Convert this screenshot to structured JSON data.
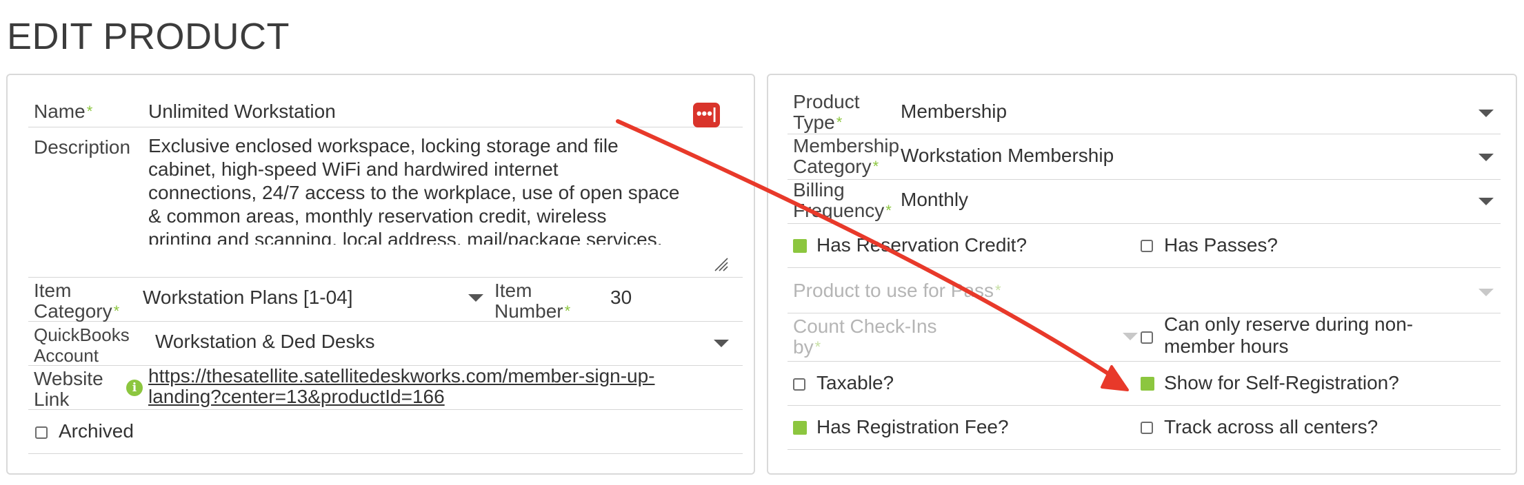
{
  "page": {
    "title": "EDIT PRODUCT"
  },
  "left": {
    "name_label": "Name",
    "name_value": "Unlimited Workstation",
    "description_label": "Description",
    "description_value": "Exclusive enclosed workspace, locking storage and file\ncabinet, high-speed WiFi and hardwired internet\nconnections, 24/7 access to the workplace, use of open space\n& common areas, monthly reservation credit, wireless\nprinting and scanning, local address, mail/package services,\nan online presence on Satellite Workplaces' website, and",
    "item_category_label": "Item Category",
    "item_category_value": "Workstation Plans [1-04]",
    "item_number_label": "Item Number",
    "item_number_value": "30",
    "quickbooks_label": "QuickBooks Account",
    "quickbooks_value": "Workstation & Ded Desks",
    "website_label": "Website Link",
    "website_link_line1": "https://thesatellite.satellitedeskworks.com/member-sign-up-",
    "website_link_line2": "landing?center=13&productId=166",
    "archived_label": "Archived",
    "required_mark": "*"
  },
  "right": {
    "product_type_label": "Product Type",
    "product_type_value": "Membership",
    "membership_category_label": "Membership Category",
    "membership_category_value": "Workstation Membership",
    "billing_frequency_label": "Billing Frequency",
    "billing_frequency_value": "Monthly",
    "has_reservation_credit_label": "Has Reservation Credit?",
    "has_passes_label": "Has Passes?",
    "product_for_pass_label": "Product to use for Pass",
    "count_checkins_label": "Count Check-Ins by",
    "non_member_hours_label": "Can only reserve during non-member hours",
    "taxable_label": "Taxable?",
    "self_registration_label": "Show for Self-Registration?",
    "has_registration_fee_label": "Has Registration Fee?",
    "track_all_centers_label": "Track across all centers?"
  },
  "checkboxes": {
    "archived": false,
    "has_reservation_credit": true,
    "has_passes": false,
    "non_member_hours": false,
    "taxable": false,
    "self_registration": true,
    "has_registration_fee": true,
    "track_all_centers": false
  },
  "icons": {
    "password_manager": "password-manager-icon",
    "info": "info-icon",
    "dropdown": "chevron-down-icon",
    "resize": "resize-handle-icon"
  },
  "colors": {
    "required": "#8cc63f",
    "checked": "#8cc63f",
    "annotation_arrow": "#e8392a",
    "password_button": "#d9342b"
  }
}
